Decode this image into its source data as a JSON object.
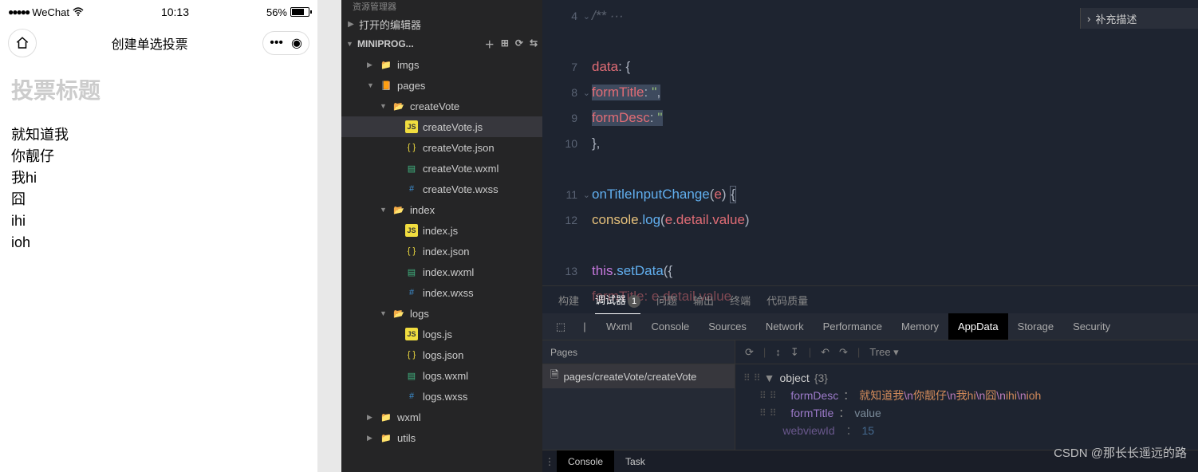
{
  "phone": {
    "carrier": "WeChat",
    "time": "10:13",
    "battery": "56%",
    "navTitle": "创建单选投票",
    "titlePlaceholder": "投票标题",
    "desc": "就知道我\n你靓仔\n我hi\n囧\nihi\nioh"
  },
  "explorer": {
    "header": "资源管理器",
    "openEditors": "打开的编辑器",
    "root": "MINIPROG...",
    "tree": [
      {
        "label": "imgs",
        "icon": "folder",
        "depth": 1,
        "open": false
      },
      {
        "label": "pages",
        "icon": "pages",
        "depth": 1,
        "open": true
      },
      {
        "label": "createVote",
        "icon": "folder-open",
        "depth": 2,
        "open": true
      },
      {
        "label": "createVote.js",
        "icon": "js",
        "depth": 3,
        "active": true
      },
      {
        "label": "createVote.json",
        "icon": "json",
        "depth": 3
      },
      {
        "label": "createVote.wxml",
        "icon": "wxml",
        "depth": 3
      },
      {
        "label": "createVote.wxss",
        "icon": "wxss",
        "depth": 3
      },
      {
        "label": "index",
        "icon": "folder-open",
        "depth": 2,
        "open": true
      },
      {
        "label": "index.js",
        "icon": "js",
        "depth": 3
      },
      {
        "label": "index.json",
        "icon": "json",
        "depth": 3
      },
      {
        "label": "index.wxml",
        "icon": "wxml",
        "depth": 3
      },
      {
        "label": "index.wxss",
        "icon": "wxss",
        "depth": 3
      },
      {
        "label": "logs",
        "icon": "folder-open",
        "depth": 2,
        "open": true
      },
      {
        "label": "logs.js",
        "icon": "js",
        "depth": 3
      },
      {
        "label": "logs.json",
        "icon": "json",
        "depth": 3
      },
      {
        "label": "logs.wxml",
        "icon": "wxml",
        "depth": 3
      },
      {
        "label": "logs.wxss",
        "icon": "wxss",
        "depth": 3
      },
      {
        "label": "wxml",
        "icon": "folder",
        "depth": 1,
        "open": false
      },
      {
        "label": "utils",
        "icon": "folder",
        "depth": 1,
        "open": false
      }
    ]
  },
  "code": {
    "lines": [
      4,
      "",
      7,
      8,
      9,
      10,
      "",
      11,
      12,
      "",
      13,
      ""
    ],
    "foldMarks": {
      "0": "down",
      "3": "down",
      "7": "down"
    }
  },
  "supplement": "补充描述",
  "panel": {
    "tabs": [
      "构建",
      "调试器",
      "问题",
      "输出",
      "终端",
      "代码质量"
    ],
    "activeTab": 1,
    "badge": "1",
    "devtoolsTabs": [
      "Wxml",
      "Console",
      "Sources",
      "Network",
      "Performance",
      "Memory",
      "AppData",
      "Storage",
      "Security"
    ],
    "activeDevtab": 6,
    "pagesHdr": "Pages",
    "pagePath": "pages/createVote/createVote",
    "treeMode": "Tree",
    "object": {
      "label": "object",
      "count": "{3}",
      "formDescKey": "formDesc",
      "formDescParts": [
        "就知道我",
        "\\n",
        "你靓仔",
        "\\n",
        "我hi",
        "\\n",
        "囧",
        "\\n",
        "ihi",
        "\\n",
        "ioh"
      ],
      "formTitleKey": "formTitle",
      "formTitleVal": "value",
      "webviewKey": "webviewId",
      "webviewVal": "15"
    },
    "consoleBtn": "Console",
    "taskBtn": "Task"
  },
  "watermark": "CSDN @那长长遥远的路"
}
